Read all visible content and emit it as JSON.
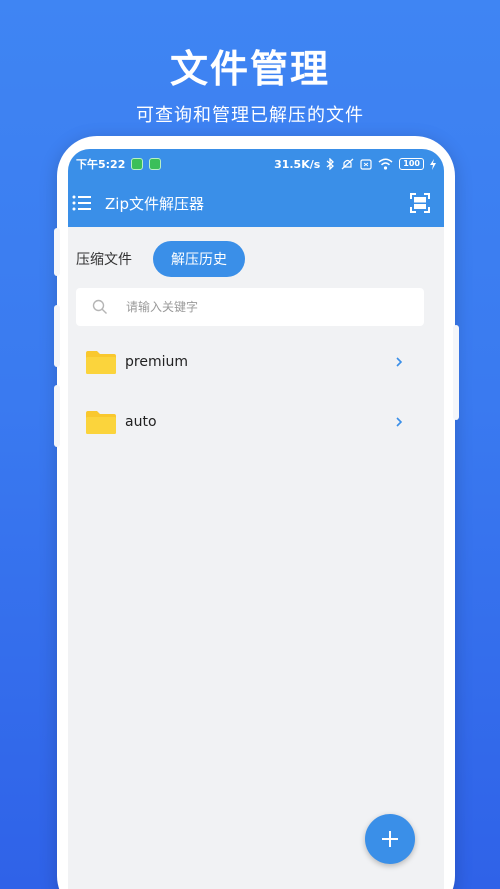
{
  "promo": {
    "title": "文件管理",
    "subtitle": "可查询和管理已解压的文件"
  },
  "status_bar": {
    "time": "下午5:22",
    "network_speed": "31.5K/s",
    "battery": "100"
  },
  "app_bar": {
    "title": "Zip文件解压器",
    "menu_icon": "menu-icon",
    "scan_icon": "scan-icon"
  },
  "tabs": [
    {
      "label": "压缩文件",
      "active": false
    },
    {
      "label": "解压历史",
      "active": true
    }
  ],
  "search": {
    "placeholder": "请输入关键字",
    "value": ""
  },
  "files": [
    {
      "name": "premium",
      "icon": "folder-icon"
    },
    {
      "name": "auto",
      "icon": "folder-icon"
    }
  ],
  "fab": {
    "icon": "plus-icon"
  },
  "colors": {
    "accent": "#3a8fe8",
    "folder": "#f9c82d",
    "background_gradient_top": "#3f85f3",
    "background_gradient_bottom": "#2f62e8"
  }
}
